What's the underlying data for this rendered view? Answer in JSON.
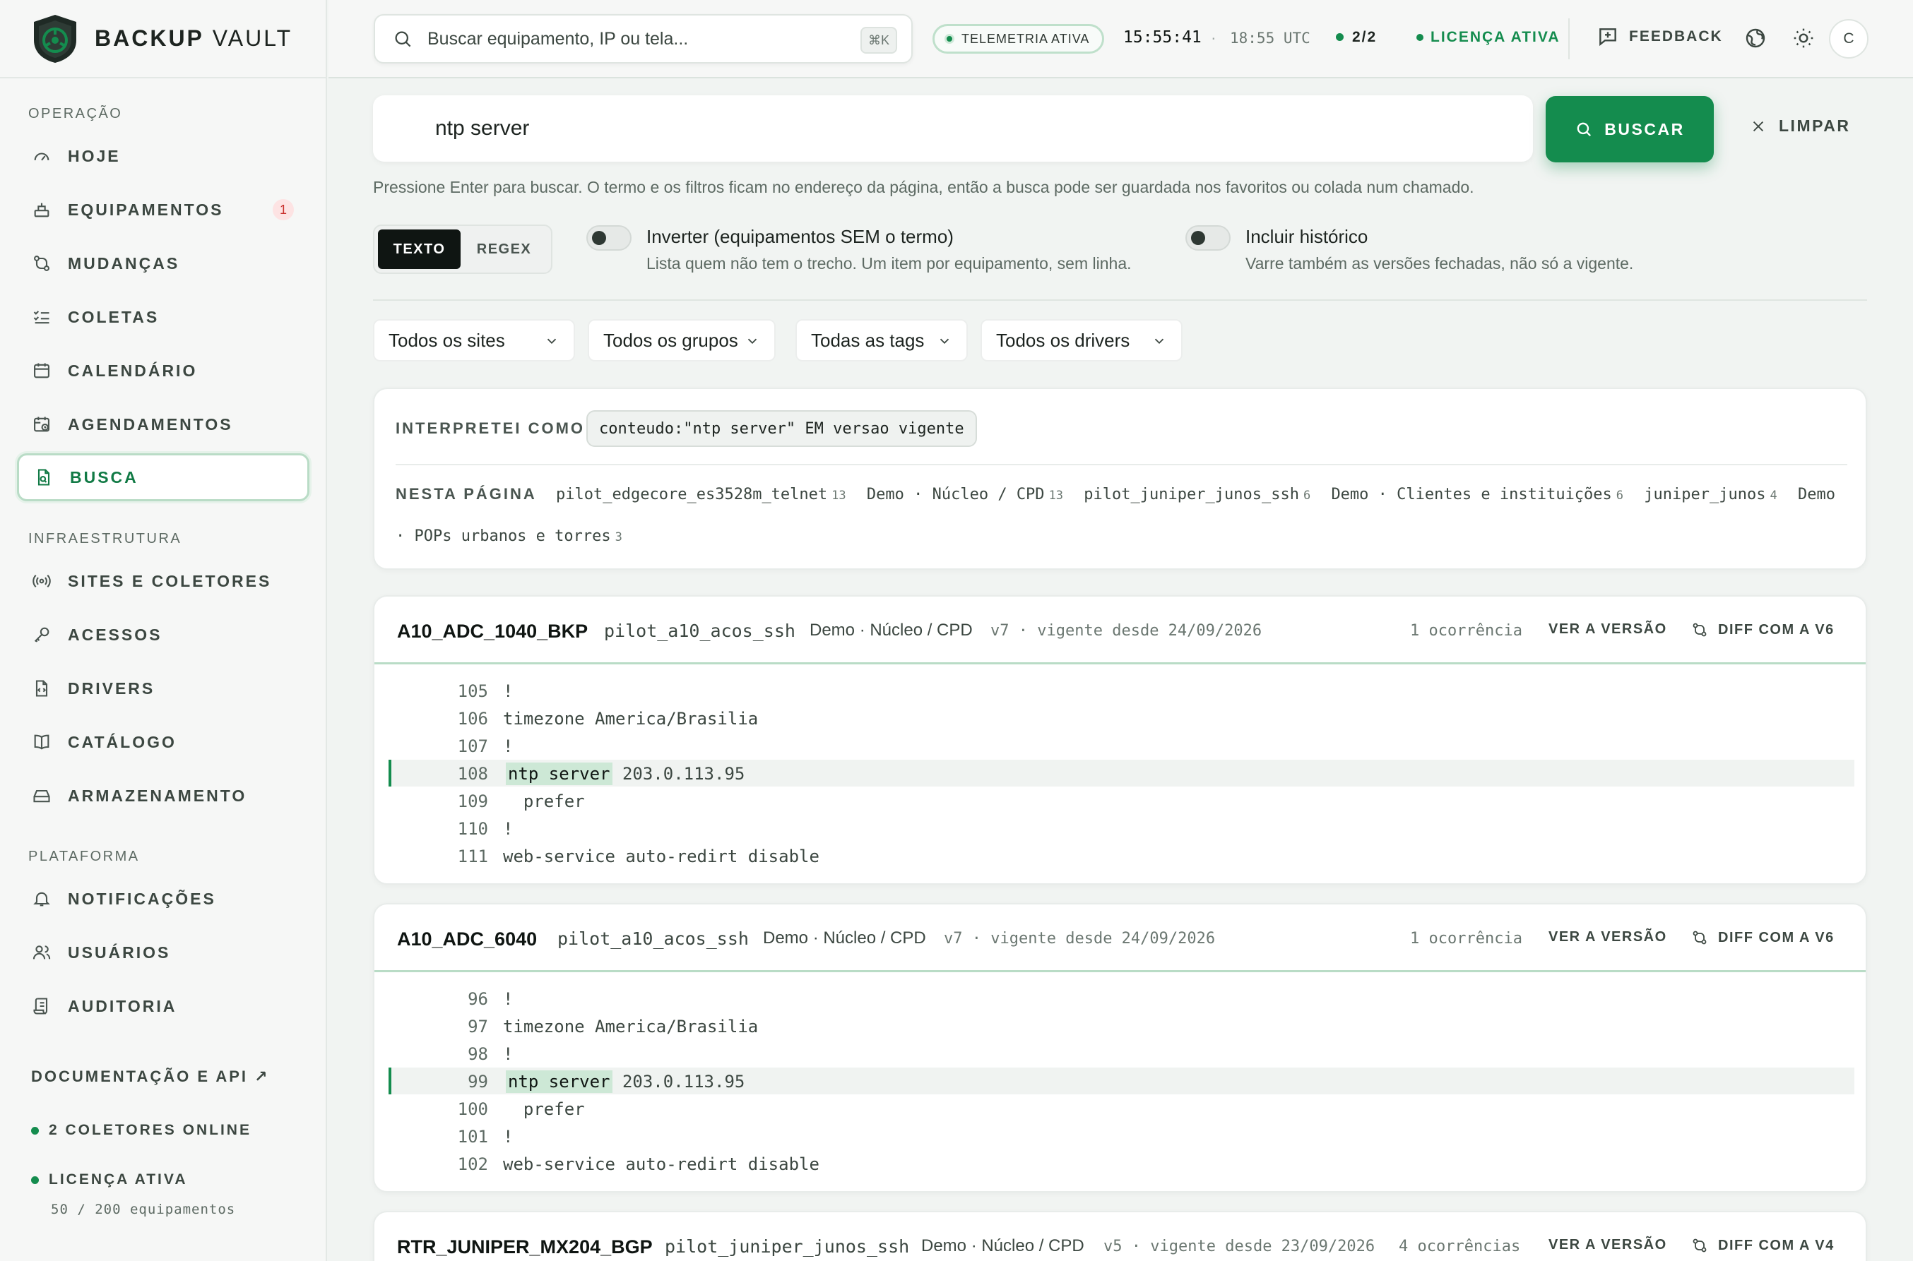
{
  "brand": {
    "bold": "BACKUP",
    "light": "VAULT"
  },
  "sidebar": {
    "sections": [
      "OPERAÇÃO",
      "INFRAESTRUTURA",
      "PLATAFORMA"
    ],
    "items": [
      {
        "label": "HOJE",
        "icon": "gauge-icon"
      },
      {
        "label": "EQUIPAMENTOS",
        "icon": "server-icon",
        "badge": "1"
      },
      {
        "label": "MUDANÇAS",
        "icon": "git-compare-icon"
      },
      {
        "label": "COLETAS",
        "icon": "list-check-icon"
      },
      {
        "label": "CALENDÁRIO",
        "icon": "calendar-icon"
      },
      {
        "label": "AGENDAMENTOS",
        "icon": "calendar-clock-icon"
      },
      {
        "label": "BUSCA",
        "icon": "file-search-icon",
        "active": true
      },
      {
        "label": "SITES E COLETORES",
        "icon": "radio-icon"
      },
      {
        "label": "ACESSOS",
        "icon": "key-icon"
      },
      {
        "label": "DRIVERS",
        "icon": "file-code-icon"
      },
      {
        "label": "CATÁLOGO",
        "icon": "book-icon"
      },
      {
        "label": "ARMAZENAMENTO",
        "icon": "hard-drive-icon"
      },
      {
        "label": "NOTIFICAÇÕES",
        "icon": "bell-icon"
      },
      {
        "label": "USUÁRIOS",
        "icon": "users-icon"
      },
      {
        "label": "AUDITORIA",
        "icon": "scroll-icon"
      }
    ],
    "docs_link": "DOCUMENTAÇÃO E API ↗",
    "collectors_status": "2 COLETORES ONLINE",
    "license_status": "LICENÇA ATIVA",
    "license_usage": "50 / 200 equipamentos"
  },
  "topbar": {
    "search_placeholder": "Buscar equipamento, IP ou tela...",
    "shortcut": "⌘K",
    "telemetry": "TELEMETRIA ATIVA",
    "local_time": "15:55:41",
    "utc_time": "18:55 UTC",
    "collectors": "2/2",
    "license": "LICENÇA ATIVA",
    "feedback": "FEEDBACK",
    "avatar": "C"
  },
  "search": {
    "query": "ntp server",
    "submit": "BUSCAR",
    "clear": "LIMPAR",
    "hint": "Pressione Enter para buscar. O termo e os filtros ficam no endereço da página, então a busca pode ser guardada nos favoritos ou colada num chamado.",
    "modes": [
      "TEXTO",
      "REGEX"
    ],
    "invert_title": "Inverter (equipamentos SEM o termo)",
    "invert_sub": "Lista quem não tem o trecho. Um item por equipamento, sem linha.",
    "history_title": "Incluir histórico",
    "history_sub": "Varre também as versões fechadas, não só a vigente.",
    "filters": [
      "Todos os sites",
      "Todos os grupos",
      "Todas as tags",
      "Todos os drivers"
    ]
  },
  "interpretation": {
    "label": "INTERPRETEI COMO",
    "query": "conteudo:\"ntp server\" EM versao vigente",
    "facets_label": "NESTA PÁGINA",
    "facets": [
      {
        "name": "pilot_edgecore_es3528m_telnet",
        "count": "13"
      },
      {
        "name": "Demo · Núcleo / CPD",
        "count": "13"
      },
      {
        "name": "pilot_juniper_junos_ssh",
        "count": "6"
      },
      {
        "name": "Demo · Clientes e instituições",
        "count": "6"
      },
      {
        "name": "juniper_junos",
        "count": "4"
      },
      {
        "name": "Demo · POPs urbanos e torres",
        "count": "3"
      }
    ]
  },
  "results": [
    {
      "device": "A10_ADC_1040_BKP",
      "driver": "pilot_a10_acos_ssh",
      "site": "Demo · Núcleo / CPD",
      "version": "v7",
      "since": "vigente desde 24/09/2026",
      "occurrences": "1 ocorrência",
      "view": "VER A VERSÃO",
      "diff": "DIFF COM A V6",
      "lines": [
        {
          "n": "105",
          "t": "!"
        },
        {
          "n": "106",
          "t": "timezone America/Brasilia"
        },
        {
          "n": "107",
          "t": "!"
        },
        {
          "n": "108",
          "m": "ntp server",
          "t": " 203.0.113.95"
        },
        {
          "n": "109",
          "t": "  prefer"
        },
        {
          "n": "110",
          "t": "!"
        },
        {
          "n": "111",
          "t": "web-service auto-redirt disable"
        }
      ]
    },
    {
      "device": "A10_ADC_6040",
      "driver": "pilot_a10_acos_ssh",
      "site": "Demo · Núcleo / CPD",
      "version": "v7",
      "since": "vigente desde 24/09/2026",
      "occurrences": "1 ocorrência",
      "view": "VER A VERSÃO",
      "diff": "DIFF COM A V6",
      "lines": [
        {
          "n": "96",
          "t": "!"
        },
        {
          "n": "97",
          "t": "timezone America/Brasilia"
        },
        {
          "n": "98",
          "t": "!"
        },
        {
          "n": "99",
          "m": "ntp server",
          "t": " 203.0.113.95"
        },
        {
          "n": "100",
          "t": "  prefer"
        },
        {
          "n": "101",
          "t": "!"
        },
        {
          "n": "102",
          "t": "web-service auto-redirt disable"
        }
      ]
    },
    {
      "device": "RTR_JUNIPER_MX204_BGP",
      "driver": "pilot_juniper_junos_ssh",
      "site": "Demo · Núcleo / CPD",
      "version": "v5",
      "since": "vigente desde 23/09/2026",
      "occurrences": "4 ocorrências",
      "view": "VER A VERSÃO",
      "diff": "DIFF COM A V4"
    }
  ]
}
